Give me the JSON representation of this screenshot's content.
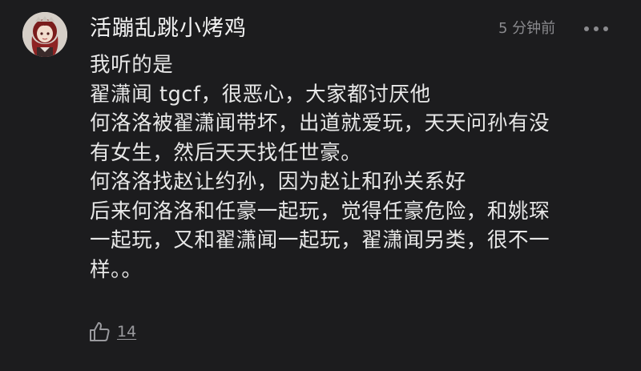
{
  "comment": {
    "username": "活蹦乱跳小烤鸡",
    "timestamp": "5 分钟前",
    "more_icon": "more-dots-icon",
    "lines": [
      "我听的是",
      "翟潇闻 tgcf，很恶心，大家都讨厌他",
      "何洛洛被翟潇闻带坏，出道就爱玩，天天问孙有没",
      "有女生，然后天天找任世豪。",
      "何洛洛找赵让约孙，因为赵让和孙关系好",
      "后来何洛洛和任豪一起玩，觉得任豪危险，和姚琛",
      "一起玩，又和翟潇闻一起玩，翟潇闻另类，很不一",
      "样。。"
    ],
    "like_icon": "thumbs-up-icon",
    "like_count": "14"
  },
  "colors": {
    "background": "#1c1c1e",
    "text": "#e8e8e8",
    "muted": "#8a8a8e"
  }
}
